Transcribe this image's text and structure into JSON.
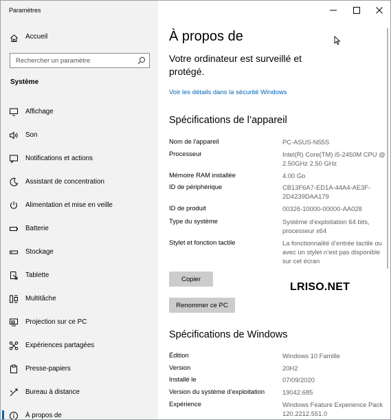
{
  "window": {
    "title": "Paramètres"
  },
  "sidebar": {
    "home_label": "Accueil",
    "search_placeholder": "Rechercher un paramètre",
    "section_label": "Système",
    "items": [
      {
        "label": "Affichage",
        "icon": "display-icon"
      },
      {
        "label": "Son",
        "icon": "speaker-icon"
      },
      {
        "label": "Notifications et actions",
        "icon": "notification-icon"
      },
      {
        "label": "Assistant de concentration",
        "icon": "moon-icon"
      },
      {
        "label": "Alimentation et mise en veille",
        "icon": "power-icon"
      },
      {
        "label": "Batterie",
        "icon": "battery-icon"
      },
      {
        "label": "Stockage",
        "icon": "storage-icon"
      },
      {
        "label": "Tablette",
        "icon": "tablet-icon"
      },
      {
        "label": "Multitâche",
        "icon": "multitask-icon"
      },
      {
        "label": "Projection sur ce PC",
        "icon": "projection-icon"
      },
      {
        "label": "Expériences partagées",
        "icon": "shared-experiences-icon"
      },
      {
        "label": "Presse-papiers",
        "icon": "clipboard-icon"
      },
      {
        "label": "Bureau à distance",
        "icon": "remote-desktop-icon"
      },
      {
        "label": "À propos de",
        "icon": "info-icon",
        "active": true
      }
    ]
  },
  "main": {
    "title": "À propos de",
    "security_text": "Votre ordinateur est surveillé et protégé.",
    "security_link": "Voir les détails dans la sécurité Windows",
    "device_heading": "Spécifications de l’appareil",
    "device_specs": [
      {
        "key": "Nom de l'appareil",
        "value": "PC-ASUS-N55S"
      },
      {
        "key": "Processeur",
        "value": "Intel(R) Core(TM) i5-2450M CPU @ 2.50GHz   2.50 GHz"
      },
      {
        "key": "Mémoire RAM installée",
        "value": "4.00 Go"
      },
      {
        "key": "ID de périphérique",
        "value": "CB13F6A7-ED1A-44A4-AE3F-2D4239DAA179"
      },
      {
        "key": "ID de produit",
        "value": "00326-10000-00000-AA028"
      },
      {
        "key": "Type du système",
        "value": "Système d’exploitation 64 bits, processeur x64"
      },
      {
        "key": "Stylet et fonction tactile",
        "value": "La fonctionnalité d’entrée tactile ou avec un stylet n’est pas disponible sur cet écran"
      }
    ],
    "copy_button": "Copier",
    "rename_button": "Renommer ce PC",
    "watermark": "LRISO.NET",
    "windows_heading": "Spécifications de Windows",
    "windows_specs": [
      {
        "key": "Édition",
        "value": "Windows 10 Famille"
      },
      {
        "key": "Version",
        "value": "20H2"
      },
      {
        "key": "Installé le",
        "value": "07/09/2020"
      },
      {
        "key": "Version du système d’exploitation",
        "value": "19042.685"
      },
      {
        "key": "Expérience",
        "value": "Windows Feature Experience Pack 120.2212.551.0"
      }
    ]
  },
  "colors": {
    "accent": "#0063b1",
    "sidebar_bg": "#f2f2f2",
    "button_bg": "#cccccc",
    "value_text": "#606060"
  }
}
